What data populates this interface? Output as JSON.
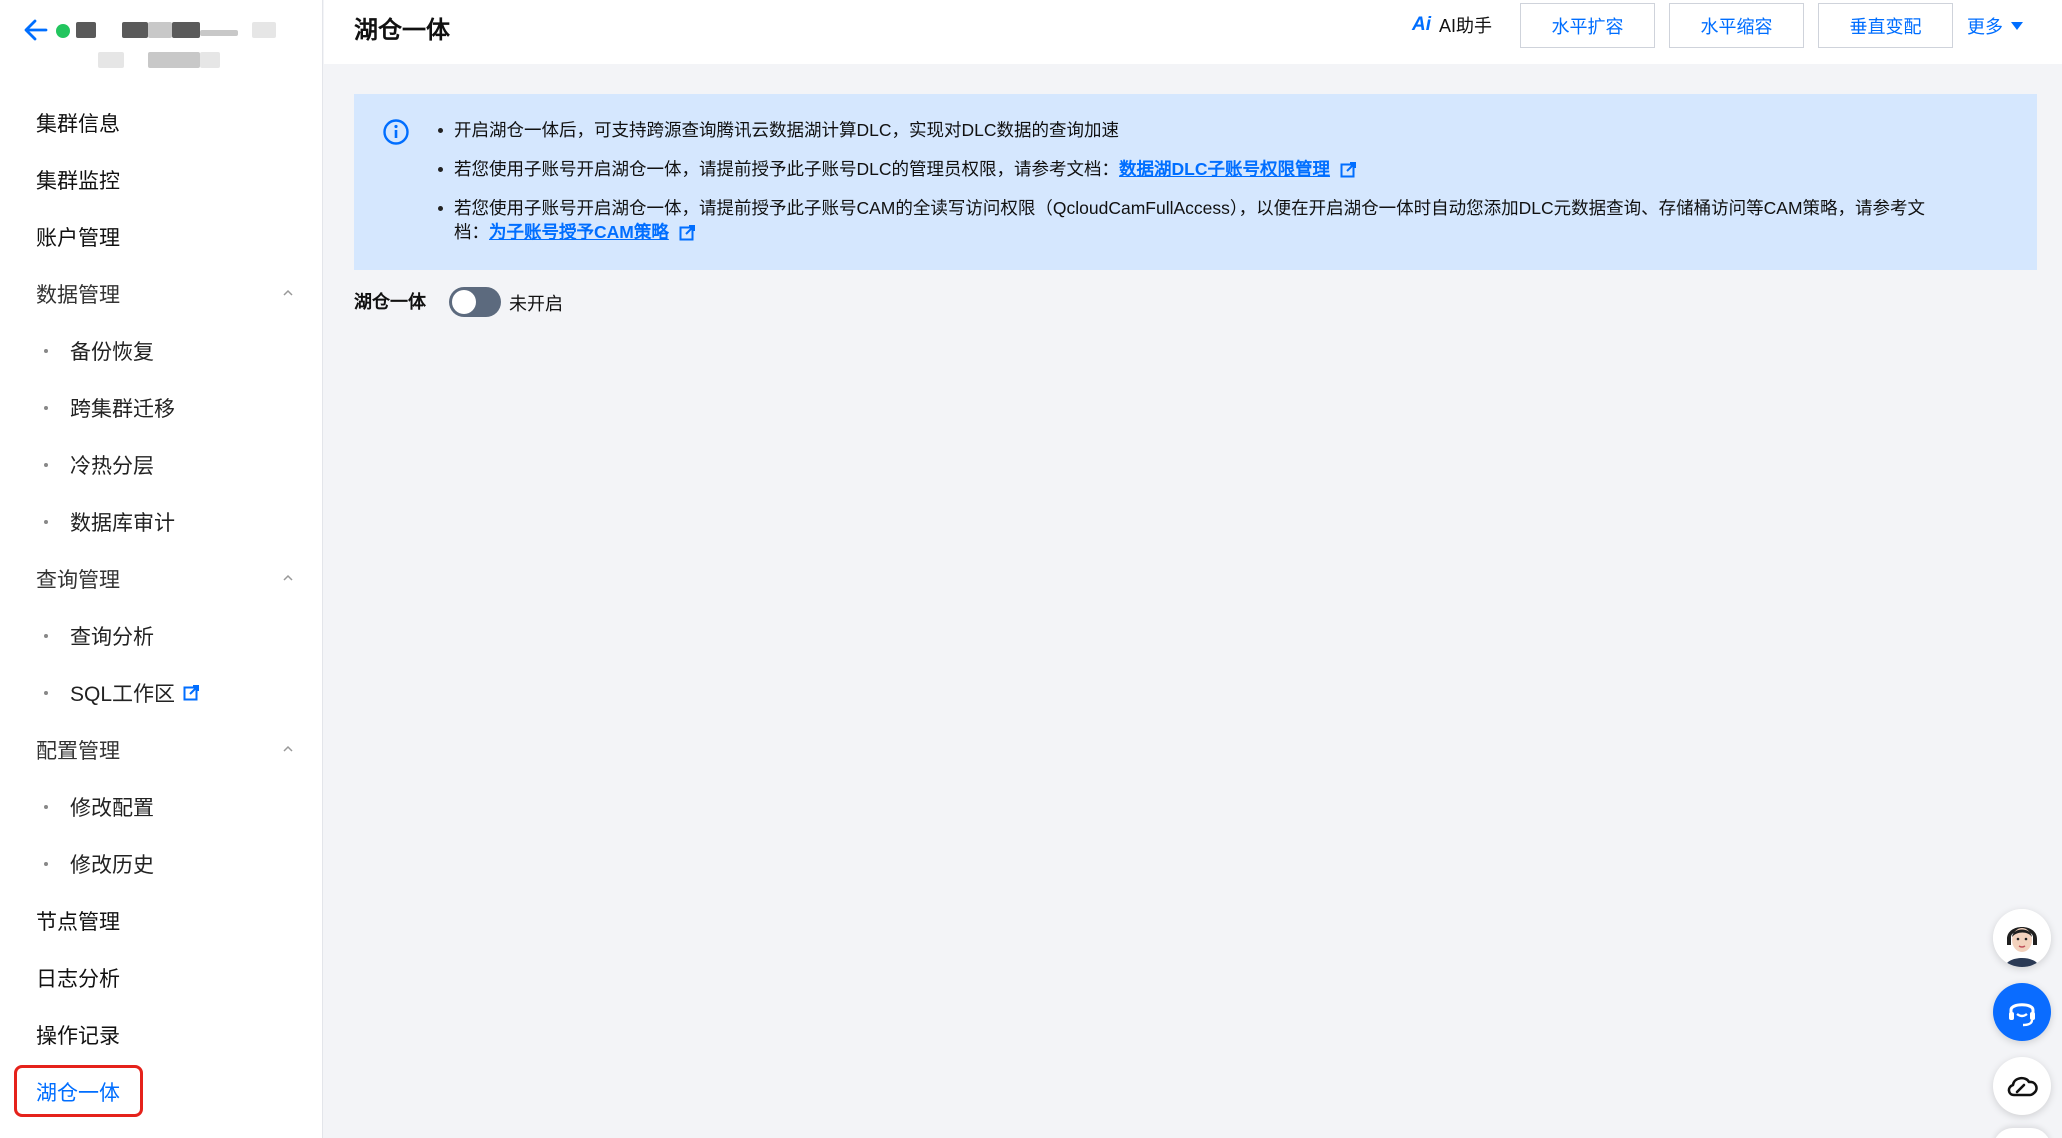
{
  "sidebar": {
    "items": [
      {
        "label": "集群信息",
        "type": "item"
      },
      {
        "label": "集群监控",
        "type": "item"
      },
      {
        "label": "账户管理",
        "type": "item"
      },
      {
        "label": "数据管理",
        "type": "group"
      },
      {
        "label": "备份恢复",
        "type": "sub"
      },
      {
        "label": "跨集群迁移",
        "type": "sub"
      },
      {
        "label": "冷热分层",
        "type": "sub"
      },
      {
        "label": "数据库审计",
        "type": "sub"
      },
      {
        "label": "查询管理",
        "type": "group"
      },
      {
        "label": "查询分析",
        "type": "sub"
      },
      {
        "label": "SQL工作区",
        "type": "sub",
        "external": true
      },
      {
        "label": "配置管理",
        "type": "group"
      },
      {
        "label": "修改配置",
        "type": "sub"
      },
      {
        "label": "修改历史",
        "type": "sub"
      },
      {
        "label": "节点管理",
        "type": "item"
      },
      {
        "label": "日志分析",
        "type": "item"
      },
      {
        "label": "操作记录",
        "type": "item"
      },
      {
        "label": "湖仓一体",
        "type": "item",
        "active": true
      }
    ]
  },
  "header": {
    "title": "湖仓一体",
    "ai_logo": "Ai",
    "ai_label": "AI助手",
    "buttons": [
      "水平扩容",
      "水平缩容",
      "垂直变配"
    ],
    "more_label": "更多"
  },
  "info": {
    "line1": "开启湖仓一体后，可支持跨源查询腾讯云数据湖计算DLC，实现对DLC数据的查询加速",
    "line2_text": "若您使用子账号开启湖仓一体，请提前授予此子账号DLC的管理员权限，请参考文档：",
    "line2_link": "数据湖DLC子账号权限管理",
    "line3_text": "若您使用子账号开启湖仓一体，请提前授予此子账号CAM的全读写访问权限（QcloudCamFullAccess），以便在开启湖仓一体时自动您添加DLC元数据查询、存储桶访问等CAM策略，请参考文",
    "line3_text2": "档：",
    "line3_link": "为子账号授予CAM策略"
  },
  "toggle": {
    "label": "湖仓一体",
    "status": "未开启",
    "enabled": false
  },
  "colors": {
    "accent": "#006eff",
    "banner_bg": "#d5e7fe",
    "highlight_border": "#e5221b",
    "status_dot": "#22c55e"
  }
}
